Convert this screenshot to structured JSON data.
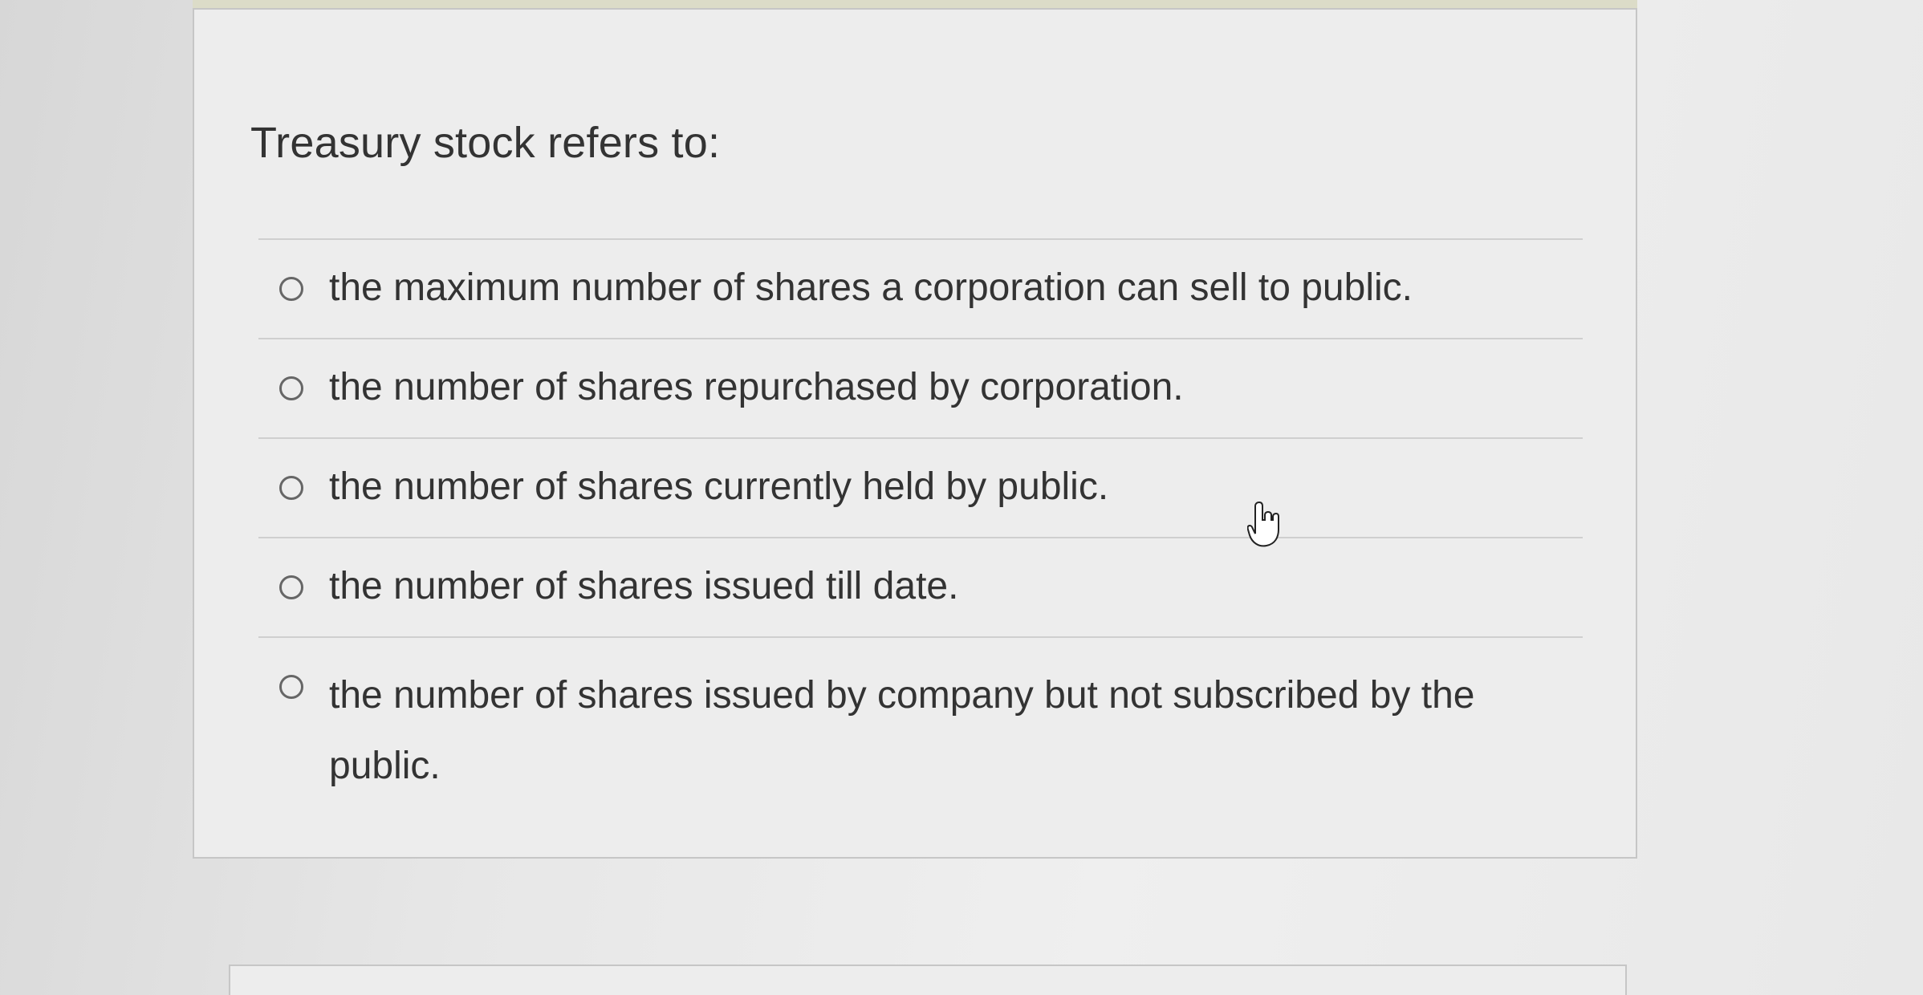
{
  "question": {
    "prompt": "Treasury stock refers to:"
  },
  "answers": [
    {
      "label": "the maximum number of shares a corporation can sell to public."
    },
    {
      "label": "the number of shares repurchased by corporation."
    },
    {
      "label": "the number of shares currently held by public."
    },
    {
      "label": "the number of shares issued till date."
    },
    {
      "label": "the number of shares issued by company but not subscribed by the public."
    }
  ],
  "icons": {
    "radio": "radio-button-icon",
    "cursor": "hand-pointer-icon"
  },
  "colors": {
    "background": "#e6e6e6",
    "card": "#ededed",
    "text": "#333333",
    "divider": "#cfcfcf"
  }
}
